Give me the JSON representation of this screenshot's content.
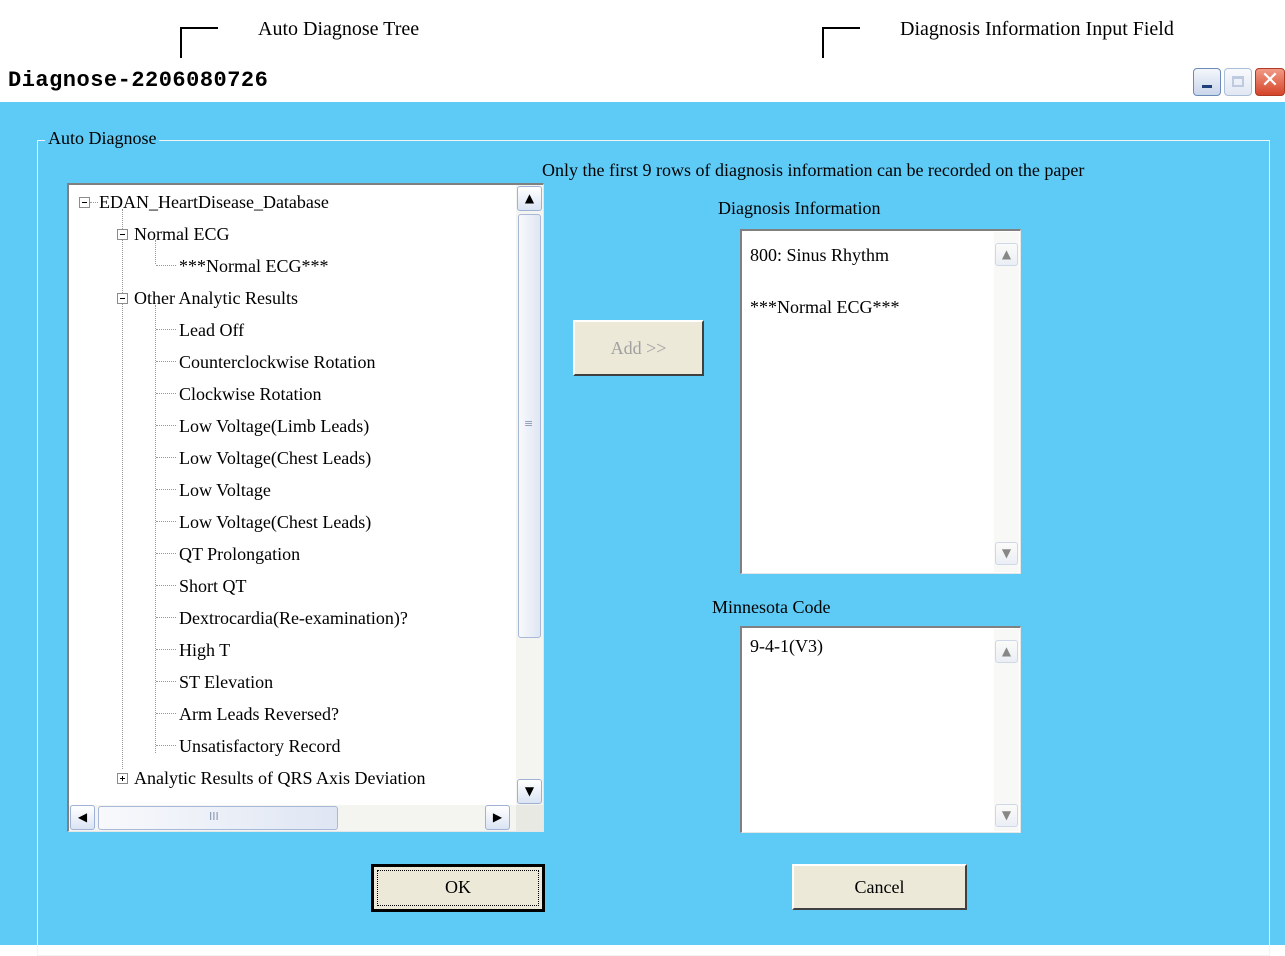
{
  "annotations": {
    "tree_label": "Auto Diagnose Tree",
    "input_label": "Diagnosis Information Input Field"
  },
  "window": {
    "title": "Diagnose-2206080726",
    "controls": {
      "minimize_icon": "minimize-icon",
      "maximize_icon": "maximize-icon",
      "close_icon": "close-icon",
      "close_glyph": "✕"
    },
    "background_color": "#5ecbf7"
  },
  "group": {
    "title": "Auto Diagnose"
  },
  "tree": {
    "root": "EDAN_HeartDisease_Database",
    "nodes": [
      {
        "label": "Normal ECG",
        "expander": "minus"
      },
      {
        "label": "***Normal ECG***"
      },
      {
        "label": "Other Analytic Results",
        "expander": "minus"
      },
      {
        "label": "Lead Off"
      },
      {
        "label": "Counterclockwise Rotation"
      },
      {
        "label": "Clockwise Rotation"
      },
      {
        "label": "Low Voltage(Limb Leads)"
      },
      {
        "label": "Low Voltage(Chest Leads)"
      },
      {
        "label": "Low Voltage"
      },
      {
        "label": "Low Voltage(Chest Leads)"
      },
      {
        "label": "QT Prolongation"
      },
      {
        "label": "Short QT"
      },
      {
        "label": "Dextrocardia(Re-examination)?"
      },
      {
        "label": "High T"
      },
      {
        "label": "ST Elevation"
      },
      {
        "label": "Arm Leads Reversed?"
      },
      {
        "label": "Unsatisfactory Record"
      },
      {
        "label": "Analytic Results of QRS Axis Deviation",
        "expander": "plus"
      }
    ]
  },
  "notice": "Only the first 9 rows of diagnosis information can be recorded on the paper",
  "add_button": {
    "label": "Add >>",
    "enabled": false
  },
  "diagnosis_info": {
    "label": "Diagnosis Information",
    "lines": [
      "800: Sinus Rhythm",
      "",
      "***Normal ECG***"
    ]
  },
  "minnesota": {
    "label": "Minnesota Code",
    "lines": [
      "9-4-1(V3)"
    ]
  },
  "buttons": {
    "ok": "OK",
    "cancel": "Cancel"
  },
  "scroll_glyphs": {
    "up": "▲",
    "down": "▼",
    "left": "◀",
    "right": "▶",
    "grip_v": "≡",
    "grip_h": "III"
  }
}
